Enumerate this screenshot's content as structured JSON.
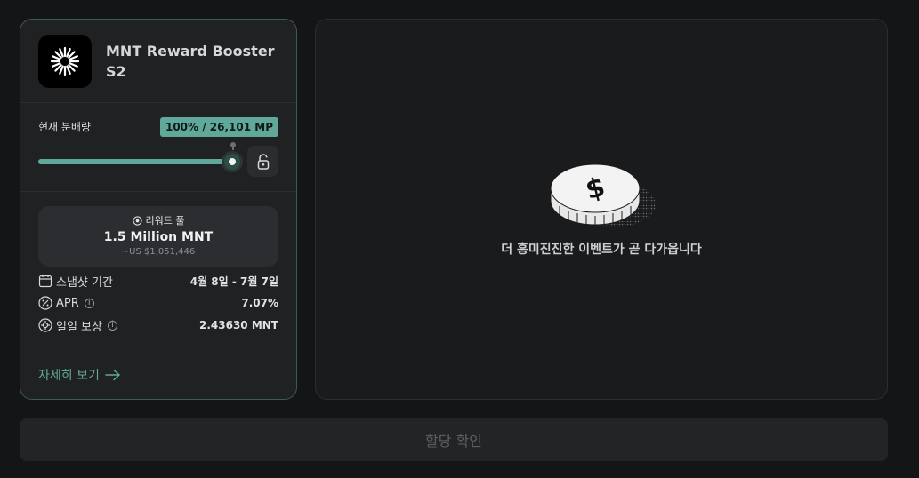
{
  "card": {
    "title": "MNT Reward Booster S2",
    "allocation": {
      "label": "현재 분배량",
      "badge": "100% / 26,101 MP",
      "slider_percent": 100
    },
    "pool": {
      "label": "리워드 풀",
      "value": "1.5 Million MNT",
      "usd": "~US $1,051,446"
    },
    "info": [
      {
        "icon": "calendar-icon",
        "label": "스냅샷 기간",
        "value": "4월 8일 - 7월 7일",
        "has_info": false
      },
      {
        "icon": "percent-icon",
        "label": "APR",
        "value": "7.07%",
        "has_info": true
      },
      {
        "icon": "gear-icon",
        "label": "일일 보상",
        "value": "2.43630 MNT",
        "has_info": true
      }
    ],
    "more_label": "자세히 보기"
  },
  "panel": {
    "message": "더 흥미진진한 이벤트가 곧 다가옵니다"
  },
  "confirm_label": "할당 확인",
  "colors": {
    "accent": "#5fa89a",
    "card_border": "#3b5c56",
    "background": "#141516"
  }
}
